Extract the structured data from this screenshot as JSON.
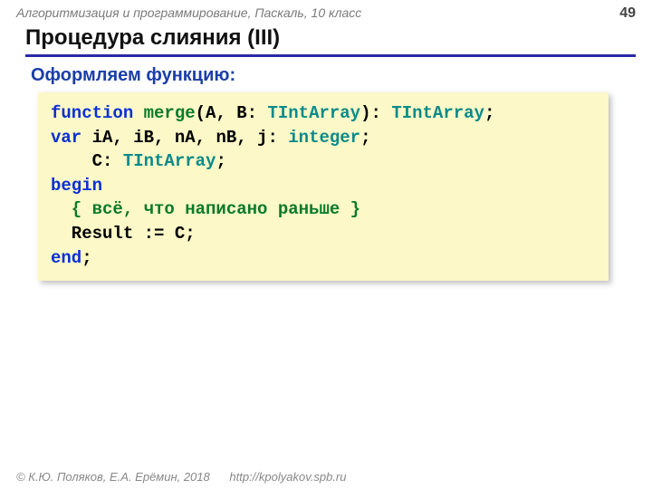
{
  "header": {
    "course": "Алгоритмизация и программирование, Паскаль, 10 класс",
    "page": "49"
  },
  "title": "Процедура слияния (III)",
  "subtitle": "Оформляем функцию:",
  "code": {
    "tokens": [
      {
        "t": "function ",
        "c": "kw-blue"
      },
      {
        "t": "merge",
        "c": "kw-green"
      },
      {
        "t": "(A, B: ",
        "c": ""
      },
      {
        "t": "TIntArray",
        "c": "kw-teal"
      },
      {
        "t": "): ",
        "c": ""
      },
      {
        "t": "TIntArray",
        "c": "kw-teal"
      },
      {
        "t": ";\n",
        "c": ""
      },
      {
        "t": "var",
        "c": "kw-blue"
      },
      {
        "t": " iA, iB, nA, nB, j: ",
        "c": ""
      },
      {
        "t": "integer",
        "c": "kw-teal"
      },
      {
        "t": ";\n",
        "c": ""
      },
      {
        "t": "    C: ",
        "c": ""
      },
      {
        "t": "TIntArray",
        "c": "kw-teal"
      },
      {
        "t": ";\n",
        "c": ""
      },
      {
        "t": "begin",
        "c": "kw-blue"
      },
      {
        "t": "\n",
        "c": ""
      },
      {
        "t": "  { всё, что написано раньше }",
        "c": "kw-green"
      },
      {
        "t": "\n  Result := C;\n",
        "c": ""
      },
      {
        "t": "end",
        "c": "kw-blue"
      },
      {
        "t": ";",
        "c": ""
      }
    ]
  },
  "footer": {
    "copyright": "© К.Ю. Поляков, Е.А. Ерёмин, 2018",
    "url": "http://kpolyakov.spb.ru"
  }
}
